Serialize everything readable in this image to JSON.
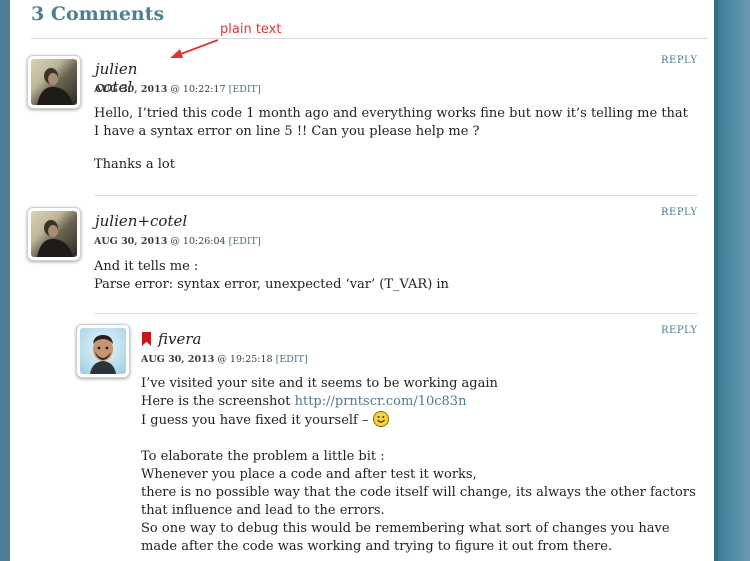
{
  "section": {
    "heading": "3 Comments"
  },
  "annotation": {
    "label": "plain text"
  },
  "comments": [
    {
      "author": "julien cotel",
      "date": "AUG 30, 2013",
      "time_prefix": "@ 10:22:17",
      "edit": "[EDIT]",
      "reply": "REPLY",
      "paragraphs": [
        "Hello, I’tried this code 1 month ago and everything works fine but now it’s telling me that I have a syntax error on line 5 !! Can you please help me ?",
        "Thanks a lot"
      ]
    },
    {
      "author": "julien+cotel",
      "date": "AUG 30, 2013",
      "time_prefix": "@ 10:26:04",
      "edit": "[EDIT]",
      "reply": "REPLY",
      "lines": [
        "And it tells me :",
        "Parse error: syntax error, unexpected ‘var’ (T_VAR) in"
      ]
    },
    {
      "author": "fivera",
      "date": "AUG 30, 2013",
      "time_prefix": "@ 19:25:18",
      "edit": "[EDIT]",
      "reply": "REPLY",
      "line1": "I’ve visited your site and it seems to be working again",
      "line2_prefix": "Here is the screenshot ",
      "line2_link": "http://prntscr.com/10c83n",
      "line3": "I guess you have fixed it yourself – ",
      "para2": [
        "To elaborate the problem a little bit :",
        "Whenever you place a code and after test it works,",
        "there is no possible way that the code itself will change, its always the other factors that influence and lead to the errors.",
        "So one way to debug this would be remembering what sort of changes you have made after the code was working and trying to figure it out from there."
      ]
    }
  ],
  "colors": {
    "heading": "#4d7f95",
    "link": "#4b7a8f",
    "annotation": "#e23434",
    "bookmark": "#c7171d"
  },
  "icons": [
    "arrow-annotation-icon",
    "bookmark-icon",
    "smiley-icon"
  ]
}
